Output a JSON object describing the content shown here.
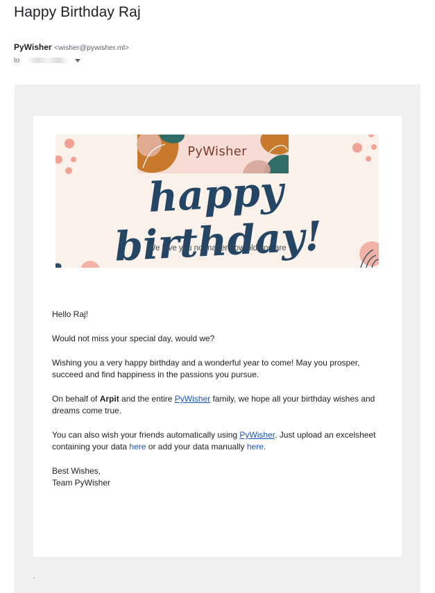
{
  "email": {
    "subject": "Happy Birthday Raj",
    "sender_name": "PyWisher",
    "sender_email": "<wisher@pywisher.ml>",
    "to_label": "to"
  },
  "banner": {
    "brand": "PyWisher",
    "headline": "happy birthday!",
    "tagline": "We love you no matter how old you are",
    "colors": {
      "background": "#faf2ea",
      "headline": "#244563",
      "coral": "#f0a394",
      "orange": "#c77a2c",
      "teal": "#2f6d66",
      "pink": "#f2b2a6"
    }
  },
  "message": {
    "greeting": "Hello Raj!",
    "line1": "Would not miss your special day, would we?",
    "line2": "Wishing you a very happy birthday and a wonderful year to come! May you prosper, succeed and find happiness in the passions you pursue.",
    "behalf_prefix": "On behalf of ",
    "behalf_name": "Arpit",
    "behalf_mid": " and the entire ",
    "behalf_link": "PyWisher",
    "behalf_suffix": " family, we hope all your birthday wishes and dreams come true.",
    "also_prefix": "You can also wish your friends automatically using ",
    "also_link": "PyWisher",
    "also_mid": ". Just upload an excelsheet containing your data ",
    "here1": "here",
    "also_or": " or add your data manually ",
    "here2": "here",
    "also_end": ".",
    "signoff": "Best Wishes,",
    "team": "Team PyWisher"
  }
}
